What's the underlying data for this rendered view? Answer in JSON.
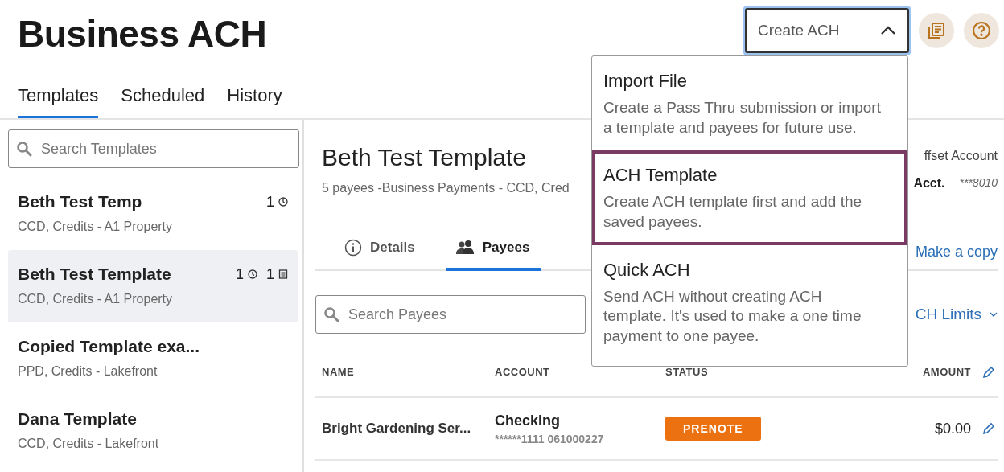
{
  "title": "Business ACH",
  "create_menu": {
    "label": "Create ACH",
    "expanded": true,
    "items": [
      {
        "title": "Import File",
        "description": "Create a Pass Thru submission or import a template and payees for future use.",
        "selected": false
      },
      {
        "title": "ACH Template",
        "description": "Create ACH template first and add the saved payees.",
        "selected": true
      },
      {
        "title": "Quick ACH",
        "description": "Send ACH without creating ACH template. It's used to make a one time payment to one payee.",
        "selected": false
      }
    ]
  },
  "tabs": [
    {
      "label": "Templates",
      "selected": true
    },
    {
      "label": "Scheduled",
      "selected": false
    },
    {
      "label": "History",
      "selected": false
    }
  ],
  "template_search": {
    "placeholder": "Search Templates"
  },
  "templates": [
    {
      "name": "Beth Test Temp",
      "subtitle": "CCD, Credits - A1 Property",
      "selected": false,
      "badges": [
        {
          "count": "1",
          "kind": "clock"
        }
      ]
    },
    {
      "name": "Beth Test Template",
      "subtitle": "CCD, Credits - A1 Property",
      "selected": true,
      "badges": [
        {
          "count": "1",
          "kind": "clock"
        },
        {
          "count": "1",
          "kind": "list"
        }
      ]
    },
    {
      "name": "Copied Template exa...",
      "subtitle": "PPD, Credits - Lakefront",
      "selected": false
    },
    {
      "name": "Dana Template",
      "subtitle": "CCD, Credits - Lakefront",
      "selected": false
    }
  ],
  "detail": {
    "title": "Beth Test Template",
    "subtitle": "5 payees -Business Payments - CCD, Cred",
    "offset_label": "ffset Account",
    "acct_label": "Acct.",
    "acct_value": "***8010",
    "copy_link": "Make a copy",
    "limits_link": "CH Limits",
    "subtabs": [
      {
        "label": "Details",
        "kind": "info",
        "selected": false
      },
      {
        "label": "Payees",
        "kind": "people",
        "selected": true
      }
    ],
    "payee_search": {
      "placeholder": "Search Payees"
    },
    "table": {
      "columns": [
        "NAME",
        "ACCOUNT",
        "STATUS",
        "AMOUNT"
      ],
      "rows": [
        {
          "name": "Bright Gardening Ser...",
          "account_type": "Checking",
          "account_number": "******1111 061000227",
          "status": "PRENOTE",
          "amount": "$0.00"
        }
      ]
    }
  }
}
